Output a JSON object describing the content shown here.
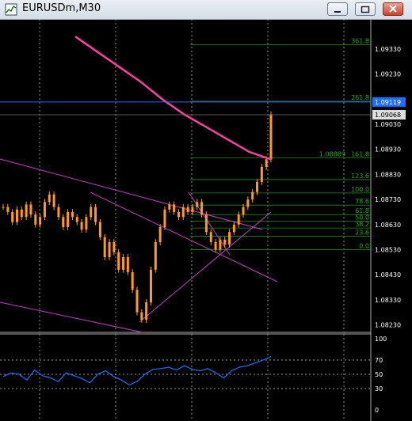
{
  "window": {
    "title": "EURUSDm,M30"
  },
  "colors": {
    "background": "#000000",
    "grid": "#c8c8c8",
    "candle": "#ff9a1f",
    "ma": "#ff3fa0",
    "channel": "#c040c0",
    "fib": "#1e8a1e",
    "fib_text": "#22a822",
    "rsi": "#1e6fff",
    "bid_line": "#1e6fff",
    "titlebar": "#dde3ea"
  },
  "price_axis": {
    "ticks": [
      "1.09330",
      "1.09230",
      "1.09119",
      "1.09068",
      "1.09030",
      "1.08930",
      "1.08830",
      "1.08730",
      "1.08630",
      "1.08530",
      "1.08430",
      "1.08330",
      "1.08230"
    ],
    "highlighted_bid": "1.09119",
    "current_price": "1.09068"
  },
  "fibonacci": {
    "levels": [
      "361.8",
      "261.8",
      "161.8",
      "123.6",
      "100.0",
      "78.6",
      "61.8",
      "50.0",
      "38.2",
      "23.6",
      "0.0"
    ],
    "price_label_161": "1.08889"
  },
  "rsi": {
    "ticks": [
      "100",
      "70",
      "50",
      "30",
      "0"
    ]
  },
  "chart_data": {
    "type": "line",
    "xlabel": "",
    "ylabel": "",
    "series": [
      {
        "values": [
          1.087,
          1.0868,
          1.0864,
          1.0869,
          1.0866,
          1.0871,
          1.0867,
          1.0863,
          1.0866,
          1.0872,
          1.0875,
          1.087,
          1.0866,
          1.0862,
          1.0868,
          1.0866,
          1.0864,
          1.0861,
          1.0866,
          1.087,
          1.0864,
          1.0858,
          1.085,
          1.0856,
          1.0852,
          1.0845,
          1.085,
          1.0844,
          1.0837,
          1.0828,
          1.0825,
          1.0832,
          1.0845,
          1.0856,
          1.0862,
          1.0869,
          1.0871,
          1.0868,
          1.0866,
          1.087,
          1.0868,
          1.087,
          1.0872,
          1.0867,
          1.086,
          1.0856,
          1.0853,
          1.0857,
          1.0855,
          1.086,
          1.0863,
          1.0867,
          1.087,
          1.0873,
          1.0876,
          1.088,
          1.0886,
          1.0889,
          1.0907
        ]
      },
      {
        "values": [
          1.0938,
          1.0932,
          1.0926,
          1.092,
          1.0913,
          1.0907,
          1.0902,
          1.0897,
          1.0892,
          1.0889
        ]
      },
      {
        "values": [
          47,
          52,
          50,
          42,
          56,
          48,
          45,
          40,
          52,
          48,
          44,
          38,
          50,
          55,
          47,
          42,
          35,
          40,
          50,
          57,
          58,
          60,
          56,
          62,
          57,
          55,
          58,
          52,
          45,
          55,
          60,
          62,
          66,
          70,
          75
        ]
      }
    ]
  }
}
